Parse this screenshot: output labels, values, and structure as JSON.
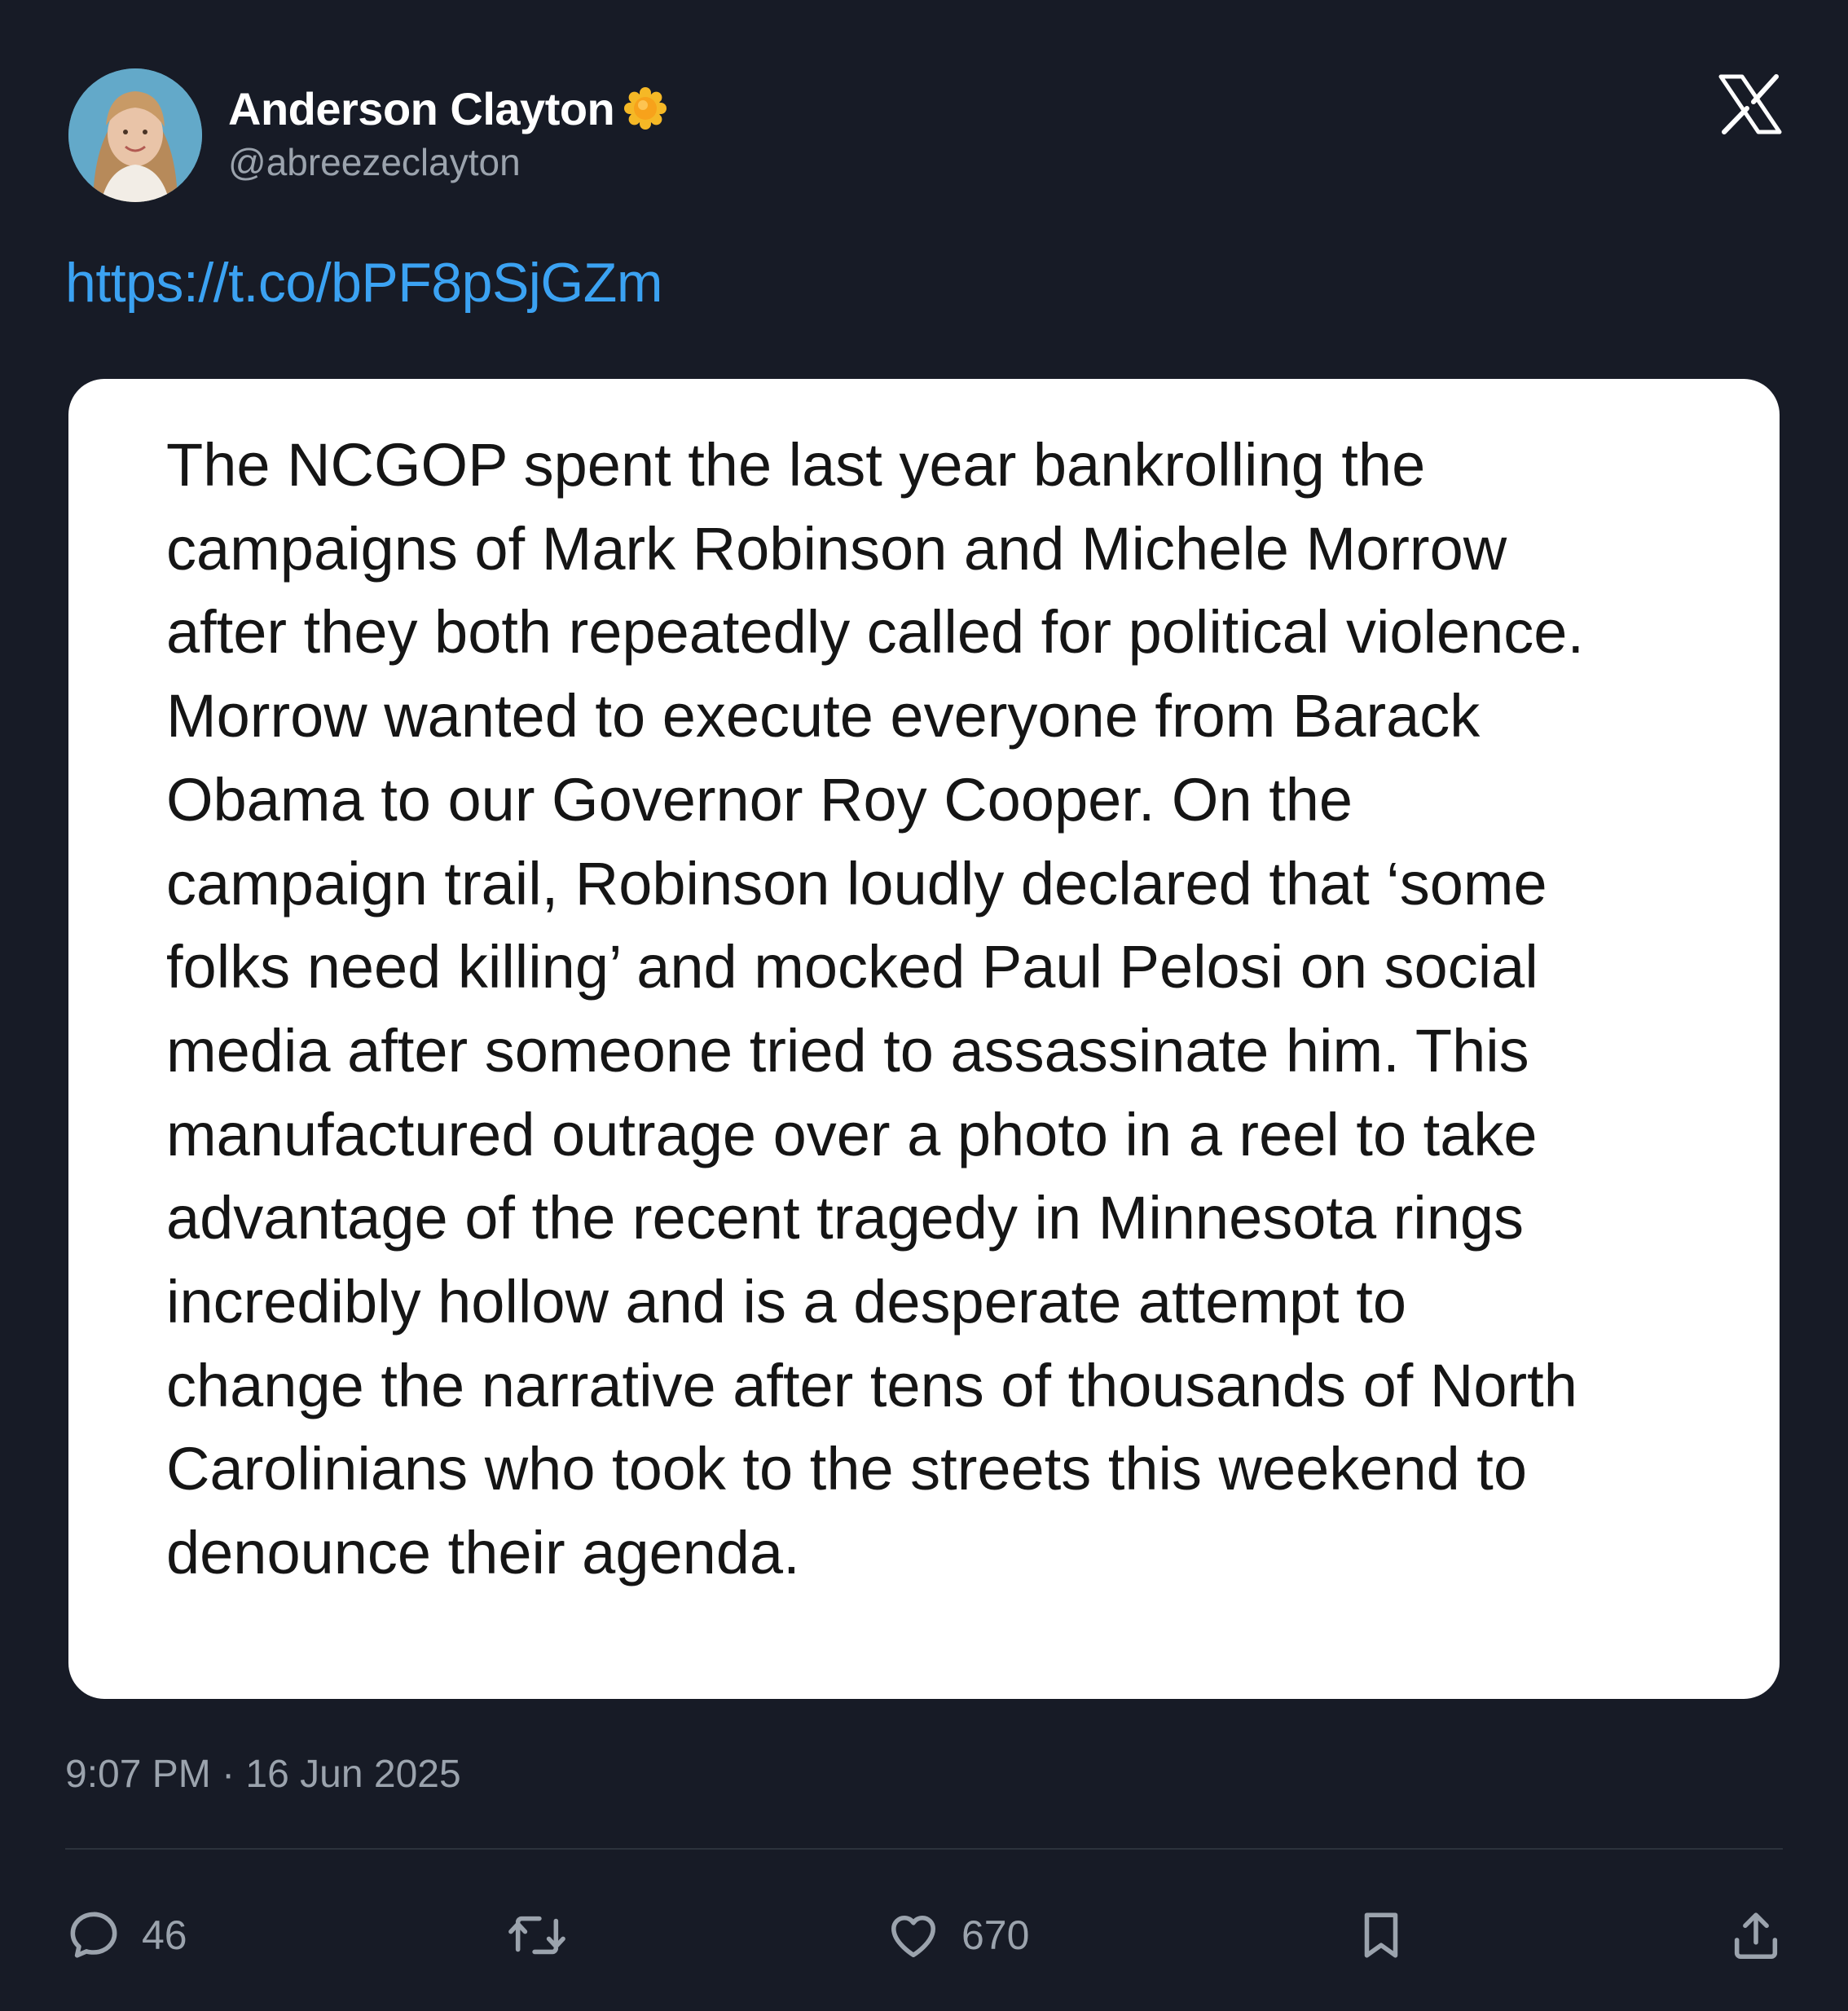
{
  "author": {
    "display_name": "Anderson Clayton",
    "handle": "@abreezeclayton",
    "verified_badge": "gold-verified-badge-icon"
  },
  "branding": {
    "logo": "x-logo-icon"
  },
  "tweet": {
    "link": "https://t.co/bPF8pSjGZm",
    "media_text_lines": [
      "The NCGOP spent the last year bankrolling the",
      "campaigns of Mark Robinson and Michele Morrow",
      "after they both repeatedly called for political violence.",
      "Morrow wanted to execute everyone from Barack",
      "Obama to our Governor Roy Cooper. On the",
      "campaign trail, Robinson loudly declared that ‘some",
      "folks need killing’ and mocked Paul Pelosi on social",
      "media after someone tried to assassinate him. This",
      "manufactured outrage over a photo in a reel to take",
      "advantage of the recent tragedy in Minnesota rings",
      "incredibly hollow and is a desperate attempt to",
      "change the narrative after tens of thousands of North",
      "Carolinians who took to the streets this weekend to",
      "denounce their agenda."
    ],
    "timestamp": "9:07 PM · 16 Jun 2025"
  },
  "actions": {
    "reply": {
      "icon": "reply-icon",
      "count": "46"
    },
    "retweet": {
      "icon": "retweet-icon",
      "count": ""
    },
    "like": {
      "icon": "heart-icon",
      "count": "670"
    },
    "bookmark": {
      "icon": "bookmark-icon",
      "count": ""
    },
    "share": {
      "icon": "share-icon",
      "count": ""
    }
  },
  "colors": {
    "background": "#171b26",
    "link": "#3ba2f2",
    "secondary_text": "#9ba3ad",
    "media_background": "#ffffff",
    "verified_gold": "#f5b826"
  }
}
